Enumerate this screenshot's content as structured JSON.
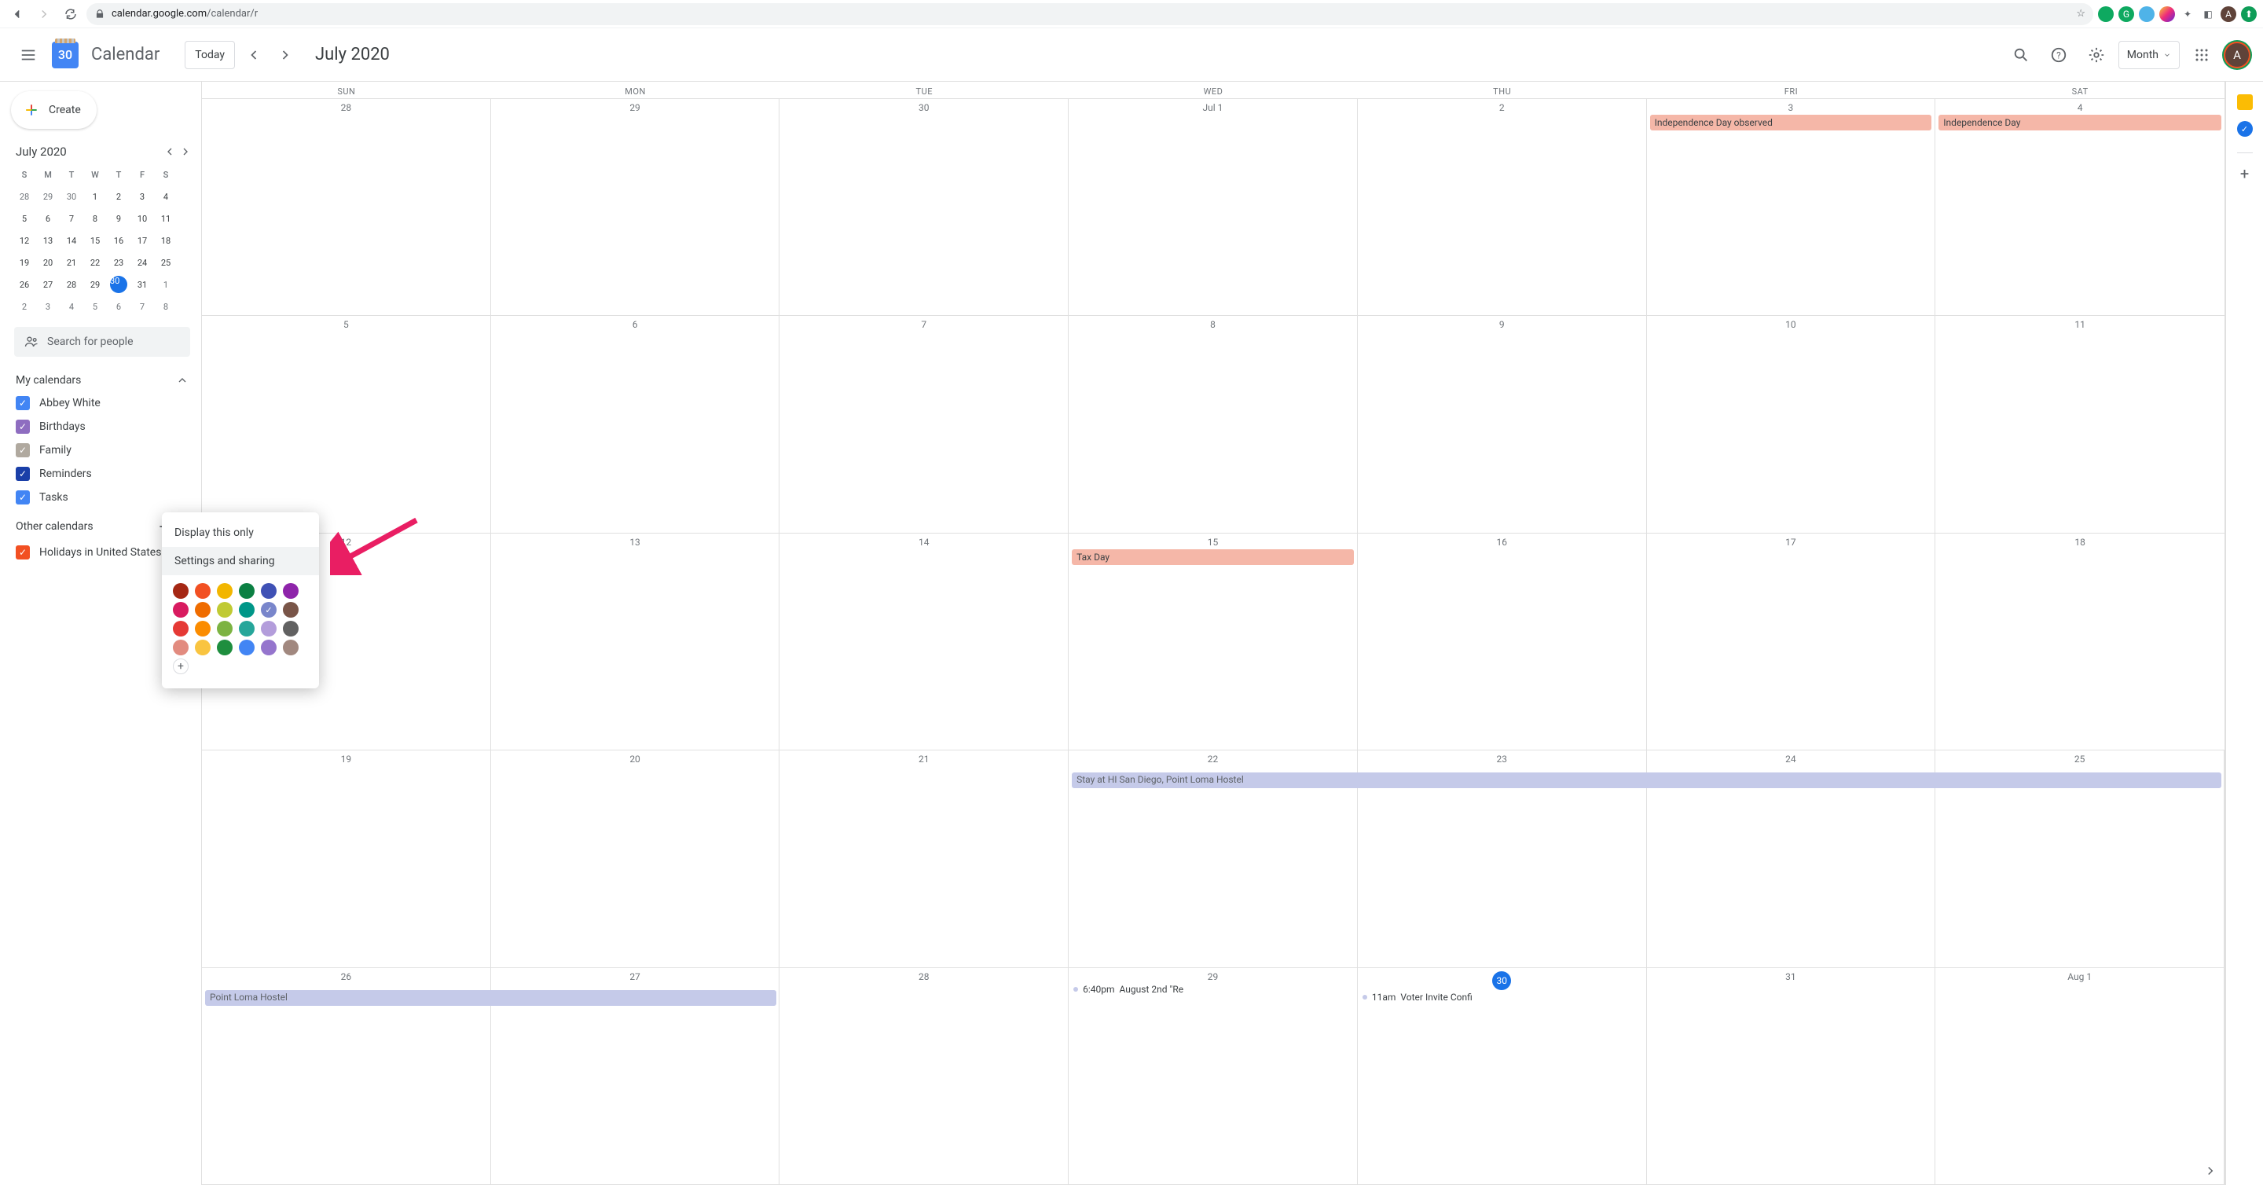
{
  "browser": {
    "url_host": "calendar.google.com",
    "url_path": "/calendar/r",
    "star_title": "Bookmark",
    "avatar_initial": "A"
  },
  "header": {
    "logo_day": "30",
    "app_name": "Calendar",
    "today_label": "Today",
    "title": "July 2020",
    "view_label": "Month",
    "avatar_initial": "A"
  },
  "mini": {
    "title": "July 2020",
    "dow": [
      "S",
      "M",
      "T",
      "W",
      "T",
      "F",
      "S"
    ],
    "rows": [
      [
        "28",
        "29",
        "30",
        "1",
        "2",
        "3",
        "4"
      ],
      [
        "5",
        "6",
        "7",
        "8",
        "9",
        "10",
        "11"
      ],
      [
        "12",
        "13",
        "14",
        "15",
        "16",
        "17",
        "18"
      ],
      [
        "19",
        "20",
        "21",
        "22",
        "23",
        "24",
        "25"
      ],
      [
        "26",
        "27",
        "28",
        "29",
        "30",
        "31",
        "1"
      ],
      [
        "2",
        "3",
        "4",
        "5",
        "6",
        "7",
        "8"
      ]
    ],
    "today_value": "30",
    "today_row": 4,
    "today_col": 4
  },
  "sidebar": {
    "create_label": "Create",
    "search_placeholder": "Search for people",
    "my_cal_label": "My calendars",
    "other_cal_label": "Other calendars",
    "calendars": [
      {
        "label": "Abbey White",
        "color": "#4285f4"
      },
      {
        "label": "Birthdays",
        "color": "#8e6dc0"
      },
      {
        "label": "Family",
        "color": "#b0a99f"
      },
      {
        "label": "Reminders",
        "color": "#1a3fa8"
      },
      {
        "label": "Tasks",
        "color": "#4285f4"
      }
    ],
    "other_calendars": [
      {
        "label": "Holidays in United States",
        "color": "#f25022"
      }
    ]
  },
  "popup": {
    "item1": "Display this only",
    "item2": "Settings and sharing",
    "colors": [
      "#a52714",
      "#f25022",
      "#f2b600",
      "#0b8043",
      "#3f51b5",
      "#8e24aa",
      "#d81b60",
      "#ef6c00",
      "#c0ca33",
      "#009688",
      "#7986cb",
      "#795548",
      "#e53935",
      "#fb8c00",
      "#7cb342",
      "#26a69a",
      "#b39ddb",
      "#616161",
      "#e28b7f",
      "#f9c440",
      "#1e8e3e",
      "#4285f4",
      "#9575cd",
      "#a1887f"
    ],
    "selected_color_index": 10
  },
  "grid": {
    "dow": [
      "SUN",
      "MON",
      "TUE",
      "WED",
      "THU",
      "FRI",
      "SAT"
    ],
    "weeks": [
      {
        "dates": [
          "28",
          "29",
          "30",
          "Jul 1",
          "2",
          "3",
          "4"
        ]
      },
      {
        "dates": [
          "5",
          "6",
          "7",
          "8",
          "9",
          "10",
          "11"
        ]
      },
      {
        "dates": [
          "12",
          "13",
          "14",
          "15",
          "16",
          "17",
          "18"
        ]
      },
      {
        "dates": [
          "19",
          "20",
          "21",
          "22",
          "23",
          "24",
          "25"
        ]
      },
      {
        "dates": [
          "26",
          "27",
          "28",
          "29",
          "30",
          "31",
          "Aug 1"
        ]
      }
    ],
    "today_week": 4,
    "today_col": 4,
    "events": {
      "ind_obs": "Independence Day observed",
      "ind_day": "Independence Day",
      "tax": "Tax Day",
      "stay": "Stay at HI San Diego, Point Loma Hostel",
      "stay2": "Point Loma Hostel",
      "e29_time": "6:40pm",
      "e29_label": "August 2nd \"Re",
      "e30_time": "11am",
      "e30_label": "Voter Invite Confi"
    }
  }
}
